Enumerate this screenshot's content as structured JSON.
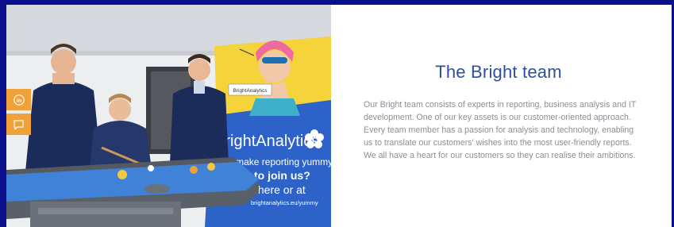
{
  "section": {
    "title": "The Bright team",
    "description": "Our Bright team consists of experts in reporting, business analysis and IT development. One of our key assets is our customer-oriented approach. Every team member has a passion for analysis and technology, enabling us to translate our customers' wishes into the most user-friendly reports. We all have a heart for our customers so they can realise their ambitions."
  },
  "photo": {
    "banner_brand": "BrightAnalytics",
    "banner_brand_small": "BrightAnalytics",
    "banner_line1": "We make reporting yummy!",
    "banner_line2": "to join us?",
    "banner_line3": "y here or at",
    "banner_url": "brightanalytics.eu/yummy"
  },
  "social": [
    {
      "icon": "linkedin-icon",
      "label": "in"
    },
    {
      "icon": "chat-icon",
      "label": ""
    }
  ],
  "colors": {
    "background": "#0a0f8c",
    "accent": "#f0a23a",
    "title": "#2f4f9e",
    "text": "#8a8f96"
  }
}
